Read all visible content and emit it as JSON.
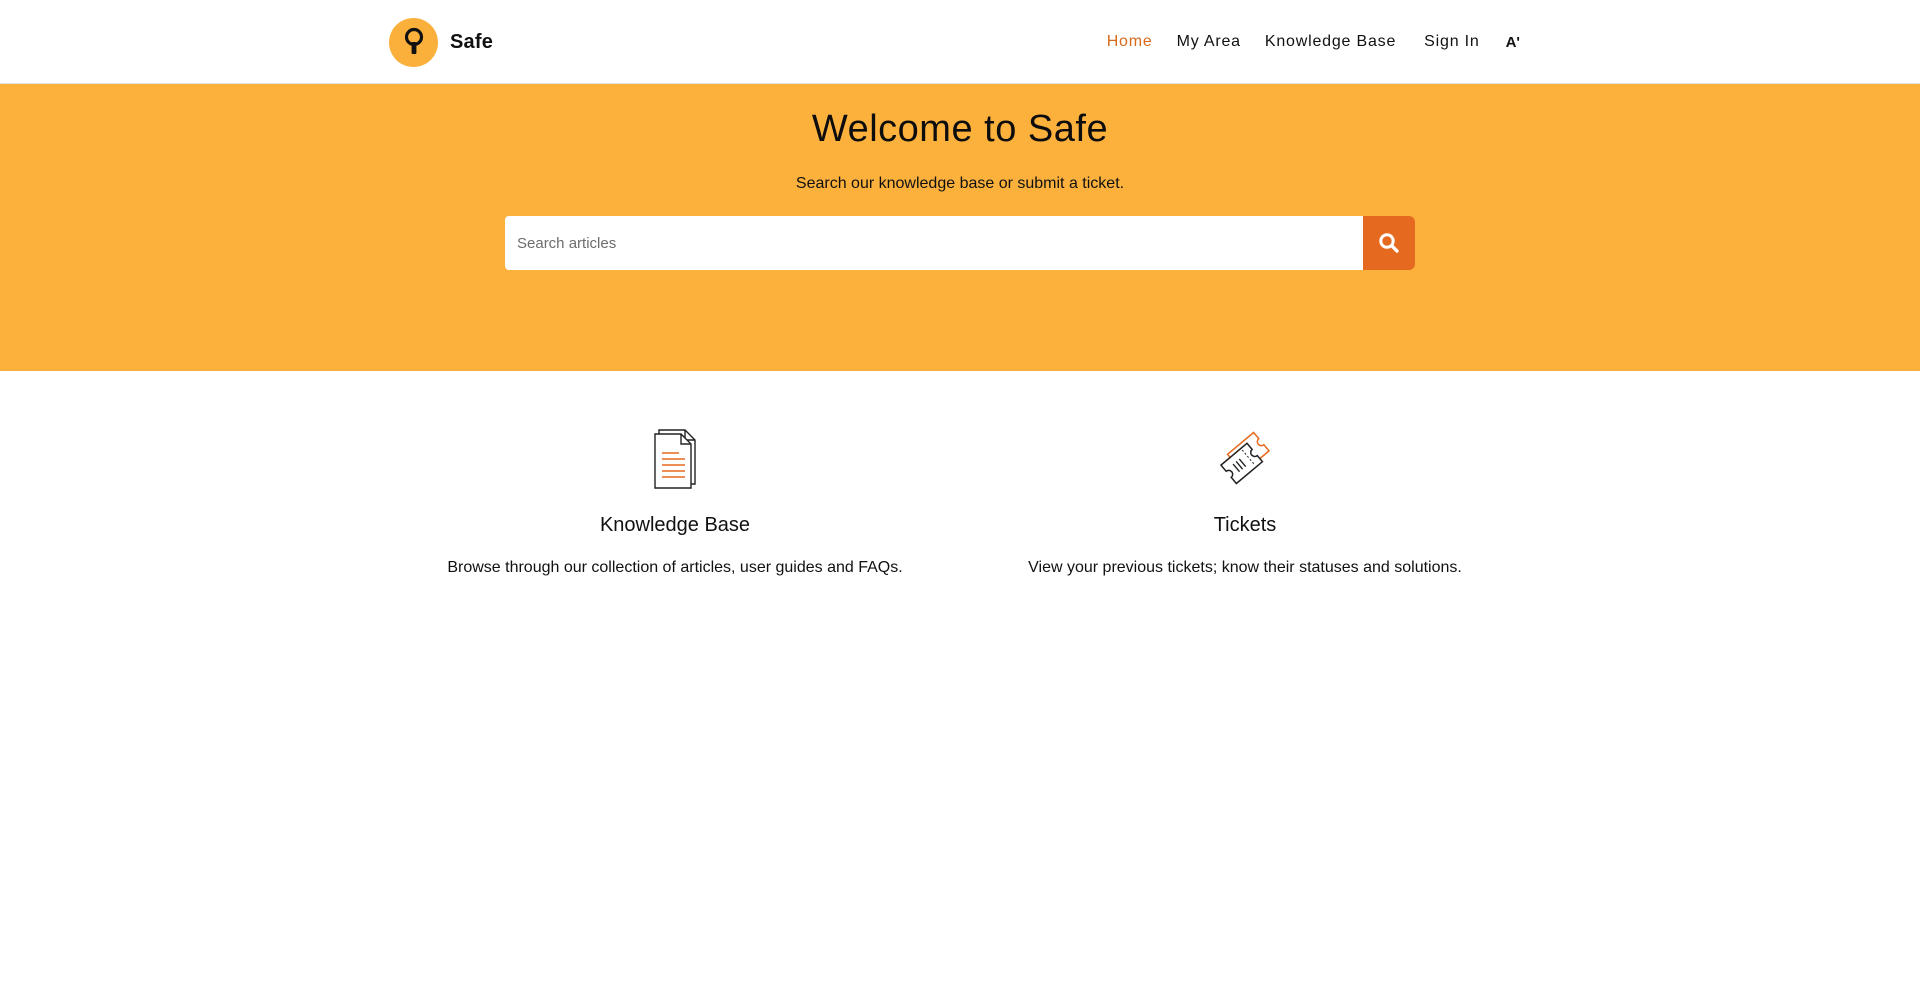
{
  "header": {
    "brand_name": "Safe",
    "nav": {
      "home": "Home",
      "my_area": "My Area",
      "knowledge_base": "Knowledge Base",
      "sign_in": "Sign In",
      "font_toggle": "A'"
    },
    "active_nav": "home"
  },
  "hero": {
    "title": "Welcome to Safe",
    "subtitle": "Search our knowledge base or submit a ticket.",
    "search": {
      "placeholder": "Search articles",
      "value": ""
    }
  },
  "cards": [
    {
      "icon": "document-icon",
      "title": "Knowledge Base",
      "description": "Browse through our collection of articles, user guides and FAQs."
    },
    {
      "icon": "ticket-icon",
      "title": "Tickets",
      "description": "View your previous tickets; know their statuses and solutions."
    }
  ],
  "colors": {
    "brand_orange": "#fcb13d",
    "accent_orange": "#e56a1f",
    "active_nav": "#d86a1a"
  }
}
